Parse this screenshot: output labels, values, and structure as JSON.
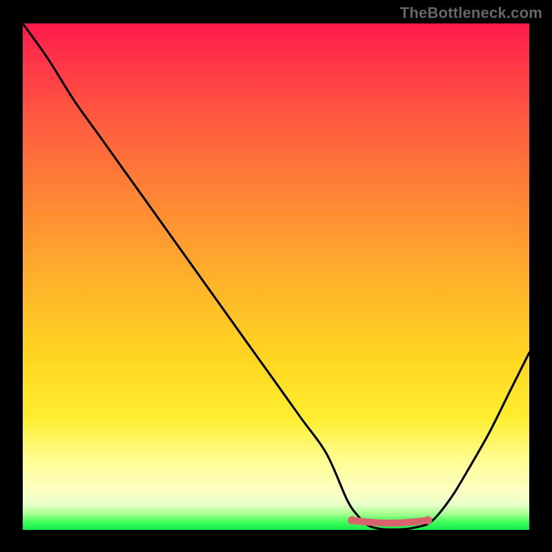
{
  "watermark": "TheBottleneck.com",
  "colors": {
    "curve": "#000000",
    "highlight": "#d9636d",
    "frame_bg": "#000000"
  },
  "chart_data": {
    "type": "line",
    "title": "",
    "xlabel": "",
    "ylabel": "",
    "xlim": [
      0,
      100
    ],
    "ylim": [
      0,
      100
    ],
    "grid": false,
    "notes": "Background encodes bottleneck severity as a vertical color gradient (top=red=high bottleneck, bottom-band=green=optimal). Curve shows bottleneck % across a swept parameter; the pink segment marks the near-zero region.",
    "series": [
      {
        "name": "bottleneck_pct",
        "x": [
          0,
          5,
          10,
          15,
          20,
          25,
          30,
          35,
          40,
          45,
          50,
          55,
          60,
          64,
          66,
          68,
          70,
          72,
          74,
          76,
          78,
          80,
          82,
          85,
          88,
          92,
          96,
          100
        ],
        "y": [
          100,
          93,
          85,
          78,
          71,
          64,
          57,
          50,
          43,
          36,
          29,
          22,
          15,
          6,
          3,
          1.0,
          0.3,
          0.1,
          0.1,
          0.2,
          0.6,
          1.2,
          3,
          7,
          12,
          19,
          27,
          35
        ]
      },
      {
        "name": "optimal_zone",
        "x": [
          65,
          80
        ],
        "y": [
          1.2,
          1.2
        ]
      }
    ]
  }
}
